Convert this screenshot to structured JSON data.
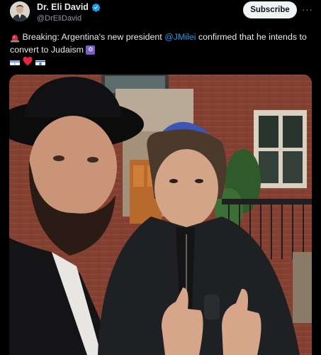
{
  "post": {
    "author_name": "Dr. Eli David",
    "author_handle": "@DrEliDavid",
    "subscribe_label": "Subscribe",
    "more_label": "···",
    "text_prefix": "Breaking: Argentina's new president ",
    "mention": "@JMilei",
    "text_suffix": " confirmed that he intends to convert to Judaism",
    "star_emoji": "✡",
    "icons": [
      "siren-icon",
      "verified-badge-icon",
      "star-of-david-icon",
      "argentina-flag-icon",
      "red-heart-icon",
      "israel-flag-icon"
    ],
    "colors": {
      "accent": "#1d9bf0",
      "background": "#000000",
      "subscribe_bg": "#eff3f4",
      "muted": "#8b98a5"
    }
  }
}
